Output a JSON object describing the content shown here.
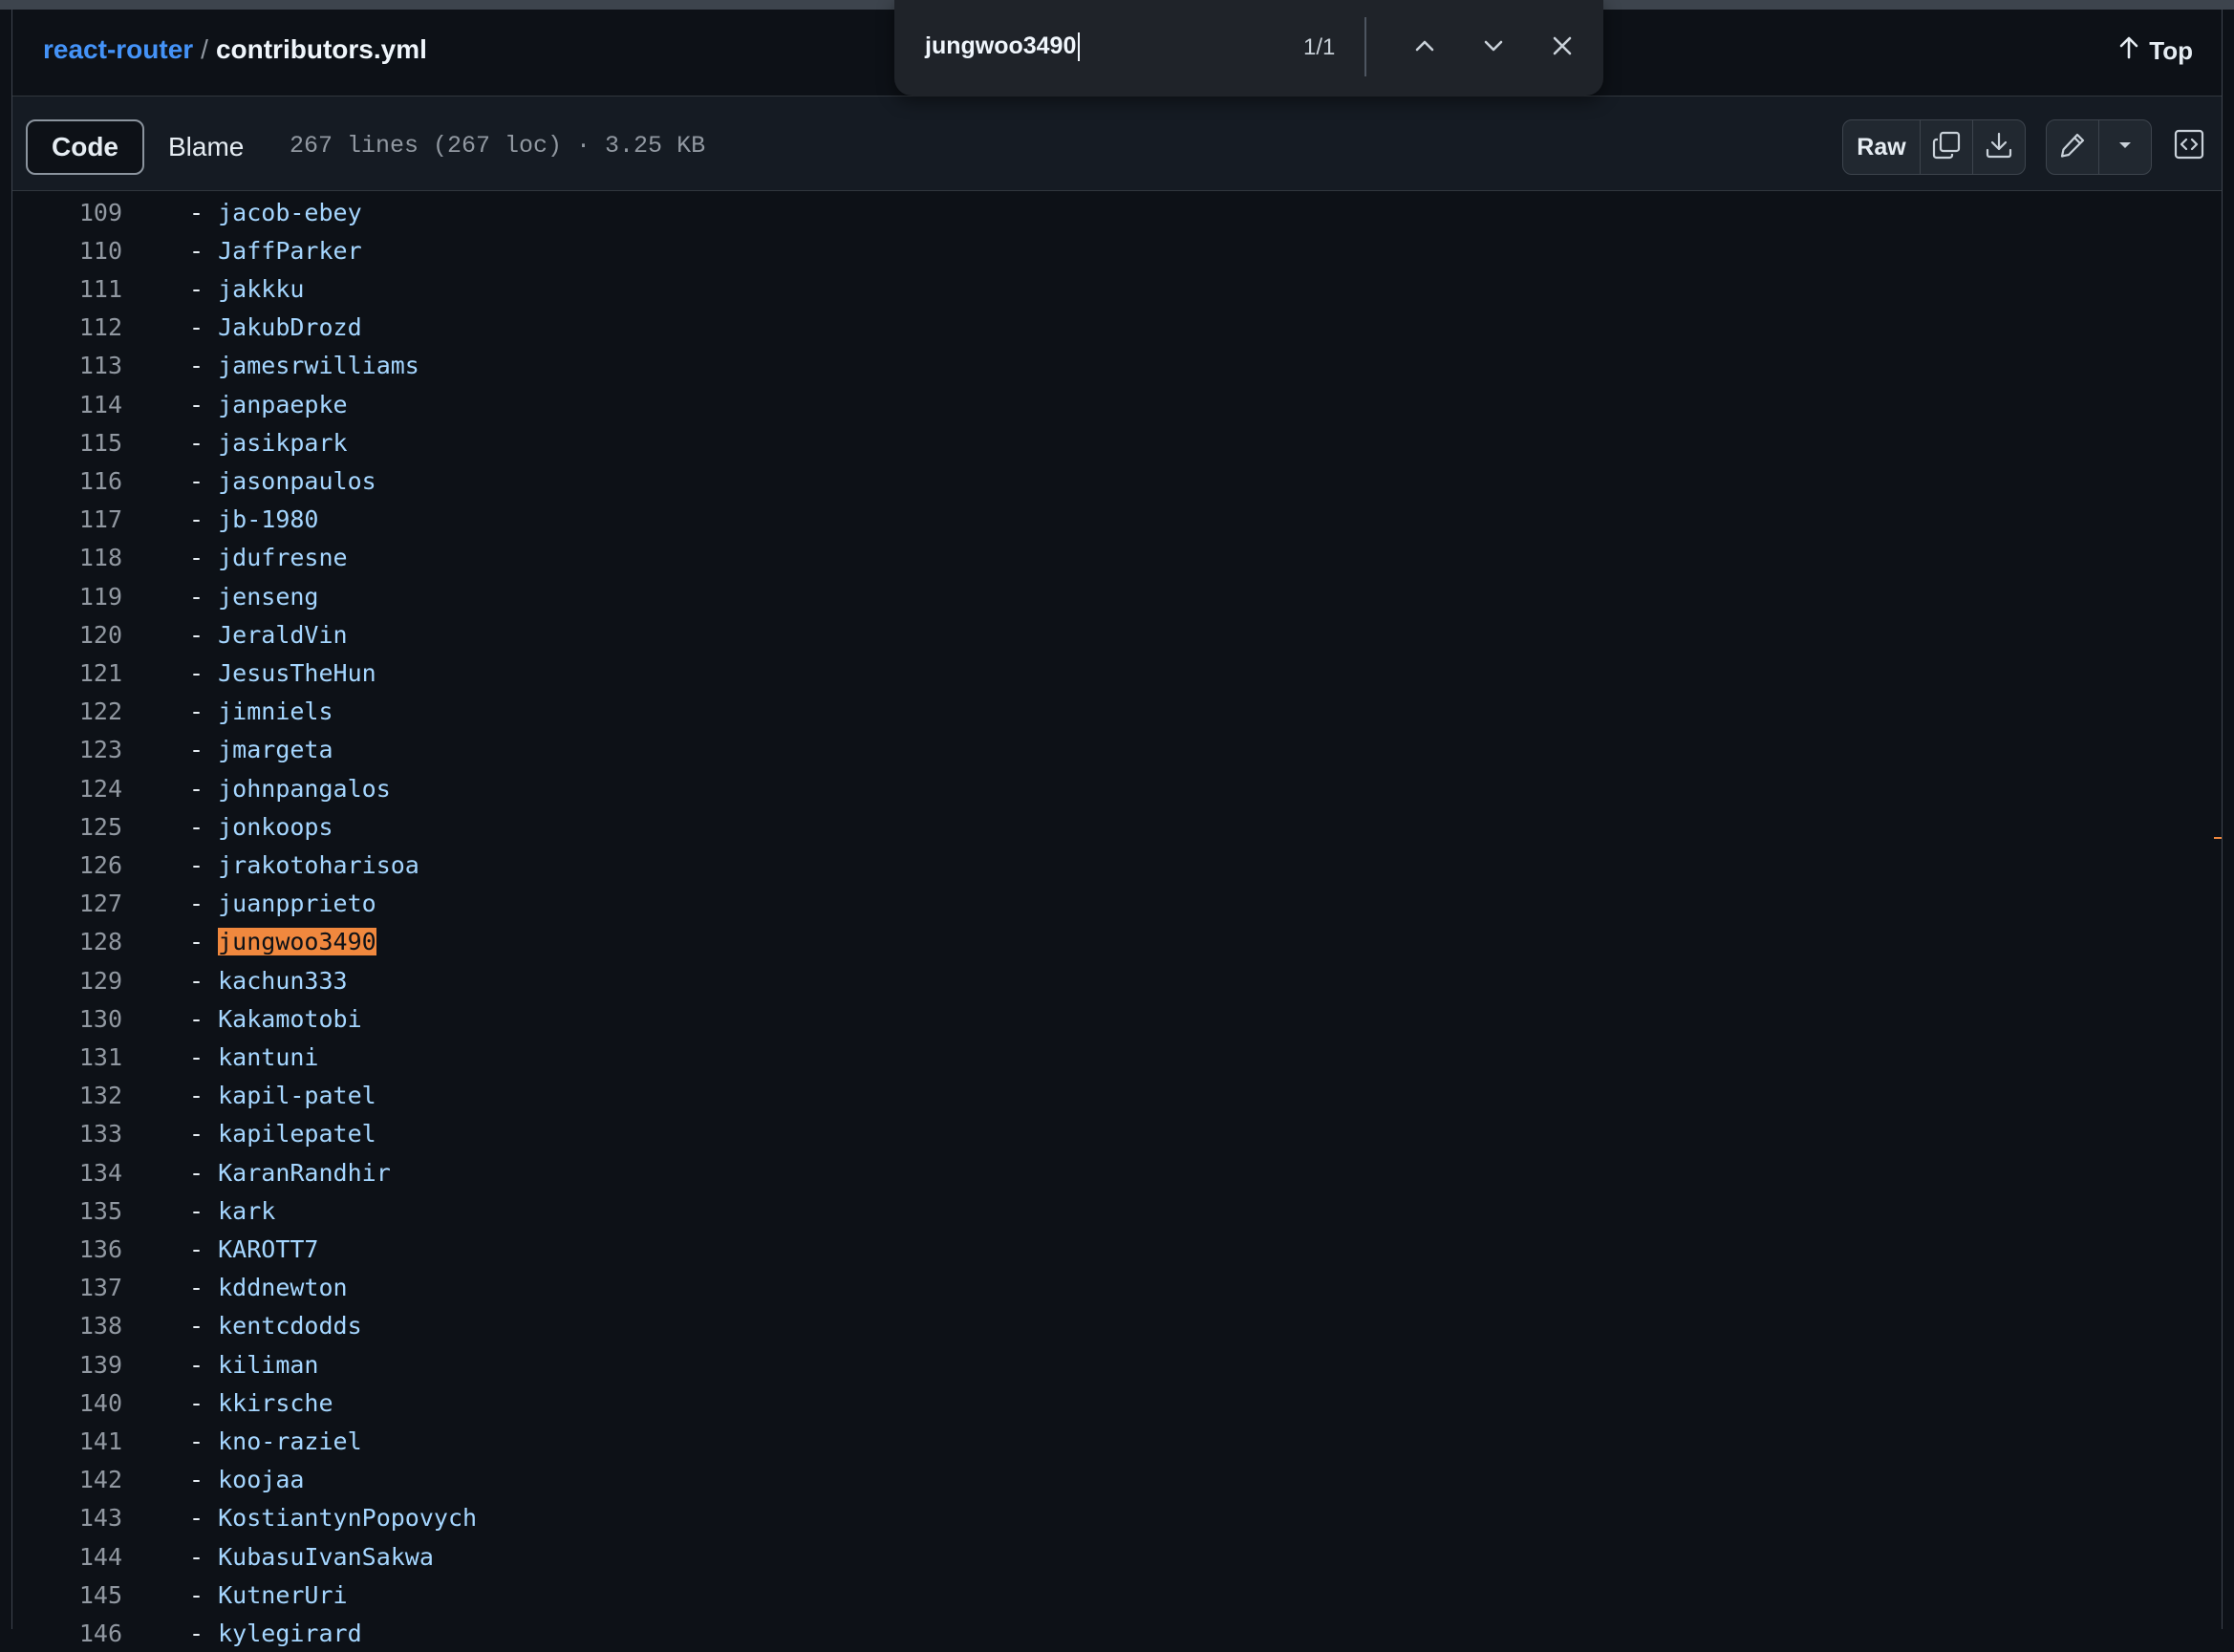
{
  "breadcrumb": {
    "repo": "react-router",
    "separator": "/",
    "file": "contributors.yml"
  },
  "top_link": {
    "icon": "arrow-up-icon",
    "label": "Top"
  },
  "find": {
    "query": "jungwoo3490",
    "count": "1/1"
  },
  "toolbar": {
    "tabs": [
      "Code",
      "Blame"
    ],
    "active_tab": "Code",
    "file_info": "267 lines (267 loc) · 3.25 KB",
    "raw_label": "Raw"
  },
  "lines": [
    {
      "num": "109",
      "dash": "-",
      "name": "jacob-ebey"
    },
    {
      "num": "110",
      "dash": "-",
      "name": "JaffParker"
    },
    {
      "num": "111",
      "dash": "-",
      "name": "jakkku"
    },
    {
      "num": "112",
      "dash": "-",
      "name": "JakubDrozd"
    },
    {
      "num": "113",
      "dash": "-",
      "name": "jamesrwilliams"
    },
    {
      "num": "114",
      "dash": "-",
      "name": "janpaepke"
    },
    {
      "num": "115",
      "dash": "-",
      "name": "jasikpark"
    },
    {
      "num": "116",
      "dash": "-",
      "name": "jasonpaulos"
    },
    {
      "num": "117",
      "dash": "-",
      "name": "jb-1980"
    },
    {
      "num": "118",
      "dash": "-",
      "name": "jdufresne"
    },
    {
      "num": "119",
      "dash": "-",
      "name": "jenseng"
    },
    {
      "num": "120",
      "dash": "-",
      "name": "JeraldVin"
    },
    {
      "num": "121",
      "dash": "-",
      "name": "JesusTheHun"
    },
    {
      "num": "122",
      "dash": "-",
      "name": "jimniels"
    },
    {
      "num": "123",
      "dash": "-",
      "name": "jmargeta"
    },
    {
      "num": "124",
      "dash": "-",
      "name": "johnpangalos"
    },
    {
      "num": "125",
      "dash": "-",
      "name": "jonkoops"
    },
    {
      "num": "126",
      "dash": "-",
      "name": "jrakotoharisoa"
    },
    {
      "num": "127",
      "dash": "-",
      "name": "juanpprieto"
    },
    {
      "num": "128",
      "dash": "-",
      "name": "jungwoo3490",
      "highlight": true
    },
    {
      "num": "129",
      "dash": "-",
      "name": "kachun333"
    },
    {
      "num": "130",
      "dash": "-",
      "name": "Kakamotobi"
    },
    {
      "num": "131",
      "dash": "-",
      "name": "kantuni"
    },
    {
      "num": "132",
      "dash": "-",
      "name": "kapil-patel"
    },
    {
      "num": "133",
      "dash": "-",
      "name": "kapilepatel"
    },
    {
      "num": "134",
      "dash": "-",
      "name": "KaranRandhir"
    },
    {
      "num": "135",
      "dash": "-",
      "name": "kark"
    },
    {
      "num": "136",
      "dash": "-",
      "name": "KAROTT7"
    },
    {
      "num": "137",
      "dash": "-",
      "name": "kddnewton"
    },
    {
      "num": "138",
      "dash": "-",
      "name": "kentcdodds"
    },
    {
      "num": "139",
      "dash": "-",
      "name": "kiliman"
    },
    {
      "num": "140",
      "dash": "-",
      "name": "kkirsche"
    },
    {
      "num": "141",
      "dash": "-",
      "name": "kno-raziel"
    },
    {
      "num": "142",
      "dash": "-",
      "name": "koojaa"
    },
    {
      "num": "143",
      "dash": "-",
      "name": "KostiantynPopovych"
    },
    {
      "num": "144",
      "dash": "-",
      "name": "KubasuIvanSakwa"
    },
    {
      "num": "145",
      "dash": "-",
      "name": "KutnerUri"
    },
    {
      "num": "146",
      "dash": "-",
      "name": "kylegirard"
    }
  ],
  "colors": {
    "accent": "#4493f8",
    "highlight": "#f0883e",
    "background": "#0d1117"
  }
}
